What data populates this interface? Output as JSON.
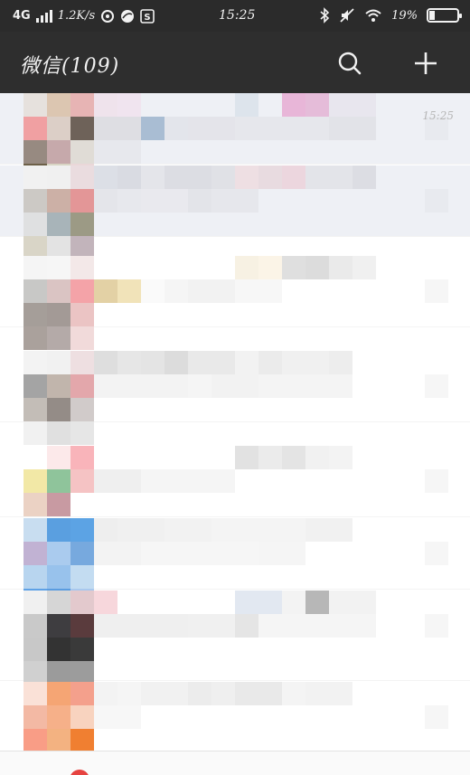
{
  "status_bar": {
    "network": "4G",
    "speed": "1.2K/s",
    "time": "15:25",
    "battery_text": "19%",
    "battery_level": 0.19
  },
  "header": {
    "title": "微信(109)",
    "search_icon": "search-icon",
    "add_icon": "plus-icon"
  },
  "chats": [
    {
      "time": "15:25"
    },
    {
      "time": ""
    },
    {
      "time": ""
    },
    {
      "time": ""
    },
    {
      "time": ""
    },
    {
      "time": ""
    },
    {
      "time": ""
    },
    {
      "time": ""
    },
    {
      "time": ""
    }
  ],
  "colors": {
    "status_bar_bg": "#2b2b2b",
    "app_bar_bg": "#2e2e2e",
    "pinned_row_bg": "#eef0f5",
    "badge_red": "#e64340"
  }
}
